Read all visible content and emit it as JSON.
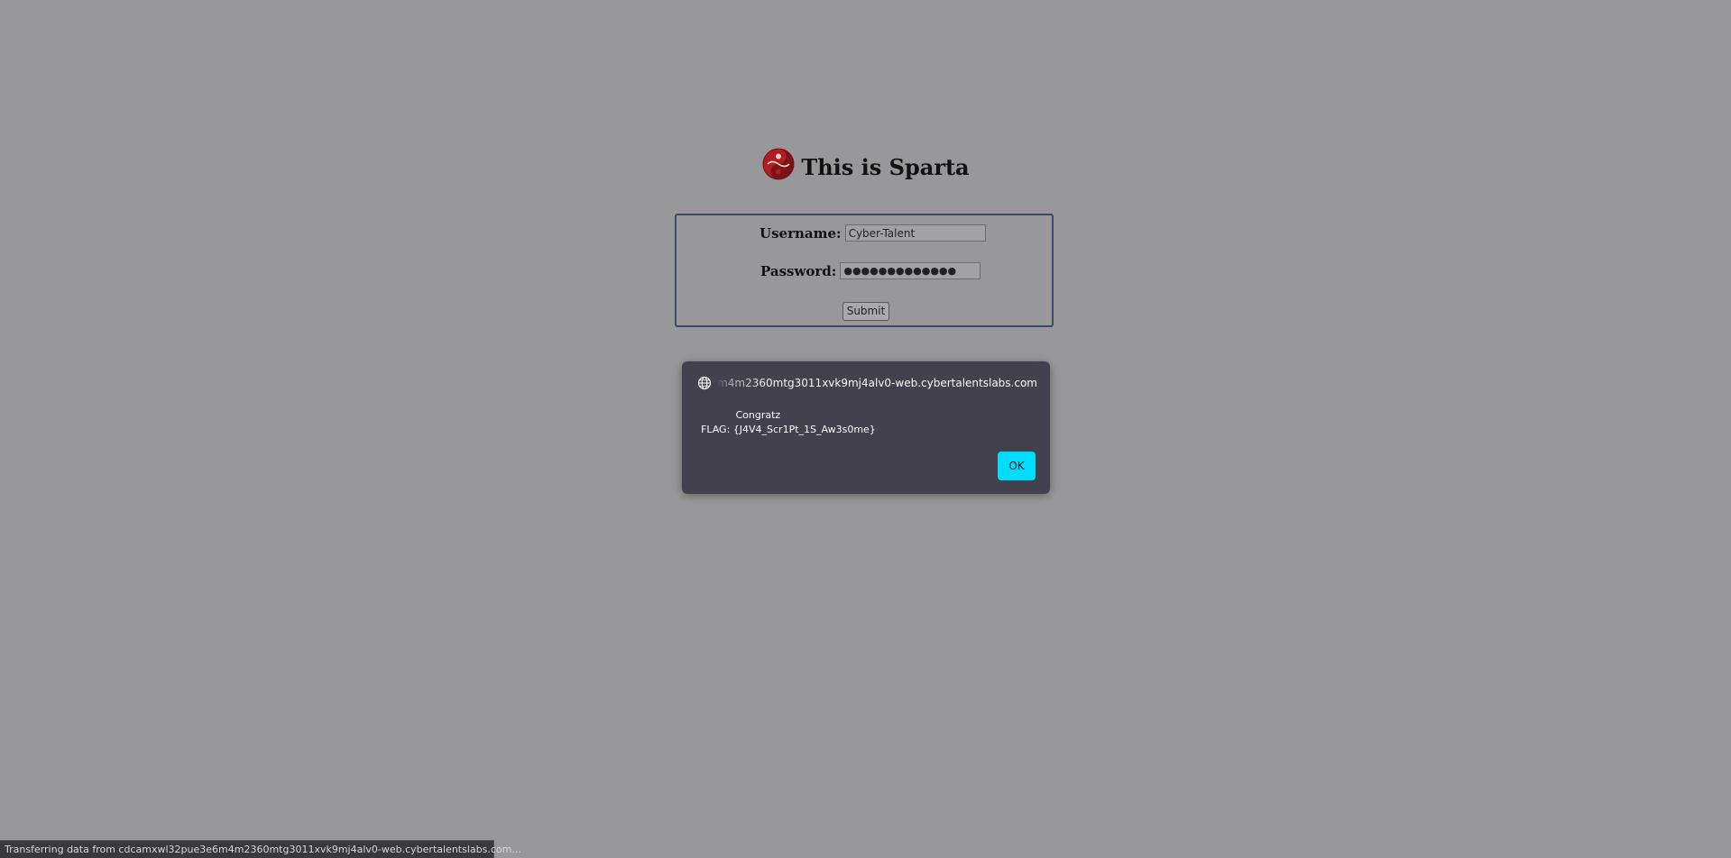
{
  "page": {
    "title": "This is Sparta",
    "background_color": "#98989a"
  },
  "login_form": {
    "username_label": "Username:",
    "username_value": "Cyber-Talent",
    "password_label": "Password:",
    "password_masked": "●●●●●●●●●●●●●",
    "submit_label": "Submit"
  },
  "alert_dialog": {
    "origin": "cdcamxwl32pue3e6m4m2360mtg3011xvk9mj4alv0-web.cybertalentslabs.com",
    "message": "           Congratz\nFLAG: {J4V4_Scr1Pt_1S_Aw3s0me}",
    "ok_label": "OK",
    "accent_color": "#00ddff",
    "icon": "globe-icon"
  },
  "status_bar": {
    "text": "Transferring data from cdcamxwl32pue3e6m4m2360mtg3011xvk9mj4alv0-web.cybertalentslabs.com..."
  },
  "logo": {
    "icon": "yin-yang-icon",
    "color": "#b01e23"
  }
}
